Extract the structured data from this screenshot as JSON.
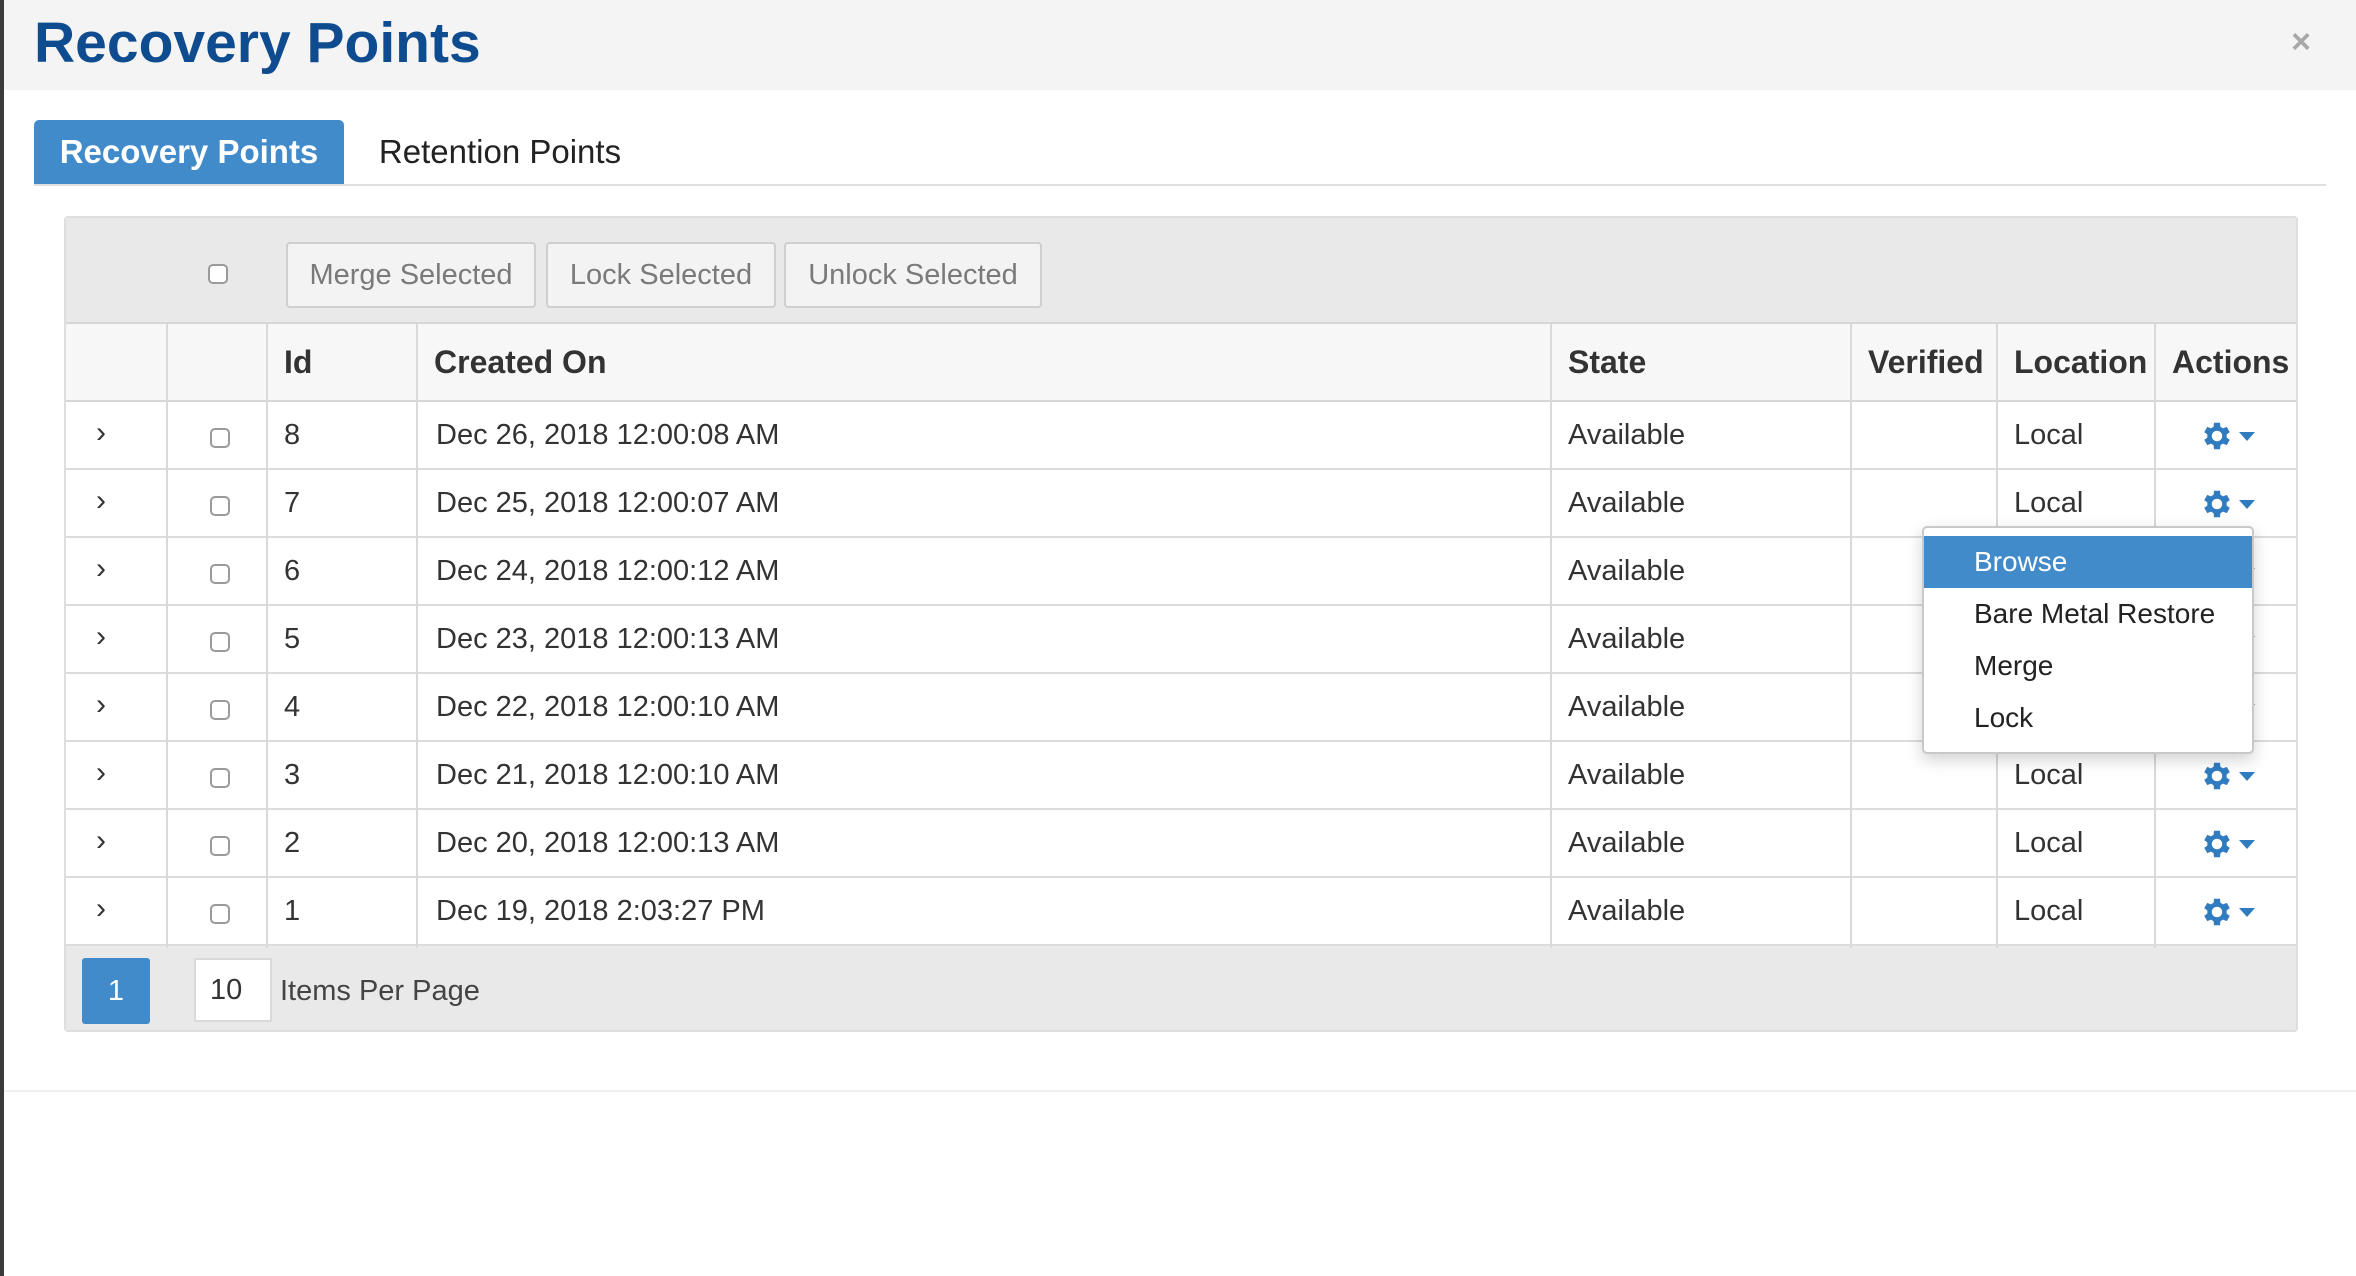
{
  "modal": {
    "title": "Recovery Points",
    "close_label": "×"
  },
  "tabs": [
    {
      "label": "Recovery Points",
      "active": true
    },
    {
      "label": "Retention Points",
      "active": false
    }
  ],
  "toolbar": {
    "merge_label": "Merge Selected",
    "lock_label": "Lock Selected",
    "unlock_label": "Unlock Selected"
  },
  "table": {
    "columns": [
      "Id",
      "Created On",
      "State",
      "Verified",
      "Location",
      "Actions"
    ],
    "rows": [
      {
        "id": "8",
        "created_on": "Dec 26, 2018 12:00:08 AM",
        "state": "Available",
        "verified": "",
        "location": "Local"
      },
      {
        "id": "7",
        "created_on": "Dec 25, 2018 12:00:07 AM",
        "state": "Available",
        "verified": "",
        "location": "Local"
      },
      {
        "id": "6",
        "created_on": "Dec 24, 2018 12:00:12 AM",
        "state": "Available",
        "verified": "",
        "location": ""
      },
      {
        "id": "5",
        "created_on": "Dec 23, 2018 12:00:13 AM",
        "state": "Available",
        "verified": "",
        "location": ""
      },
      {
        "id": "4",
        "created_on": "Dec 22, 2018 12:00:10 AM",
        "state": "Available",
        "verified": "",
        "location": ""
      },
      {
        "id": "3",
        "created_on": "Dec 21, 2018 12:00:10 AM",
        "state": "Available",
        "verified": "",
        "location": "Local"
      },
      {
        "id": "2",
        "created_on": "Dec 20, 2018 12:00:13 AM",
        "state": "Available",
        "verified": "",
        "location": "Local"
      },
      {
        "id": "1",
        "created_on": "Dec 19, 2018 2:03:27 PM",
        "state": "Available",
        "verified": "",
        "location": "Local"
      }
    ],
    "row_expand_icon": "chevron-right-icon",
    "action_icon": "gear-icon"
  },
  "pagination": {
    "current_page": "1",
    "items_per_page": "10",
    "items_per_page_label": "Items Per Page"
  },
  "actions_menu": {
    "open_for_row_id": "7",
    "items": [
      {
        "label": "Browse",
        "highlighted": true
      },
      {
        "label": "Bare Metal Restore",
        "highlighted": false
      },
      {
        "label": "Merge",
        "highlighted": false
      },
      {
        "label": "Lock",
        "highlighted": false
      }
    ]
  },
  "colors": {
    "title": "#0e4c8f",
    "accent": "#428bca",
    "gear": "#2f7cc1"
  }
}
